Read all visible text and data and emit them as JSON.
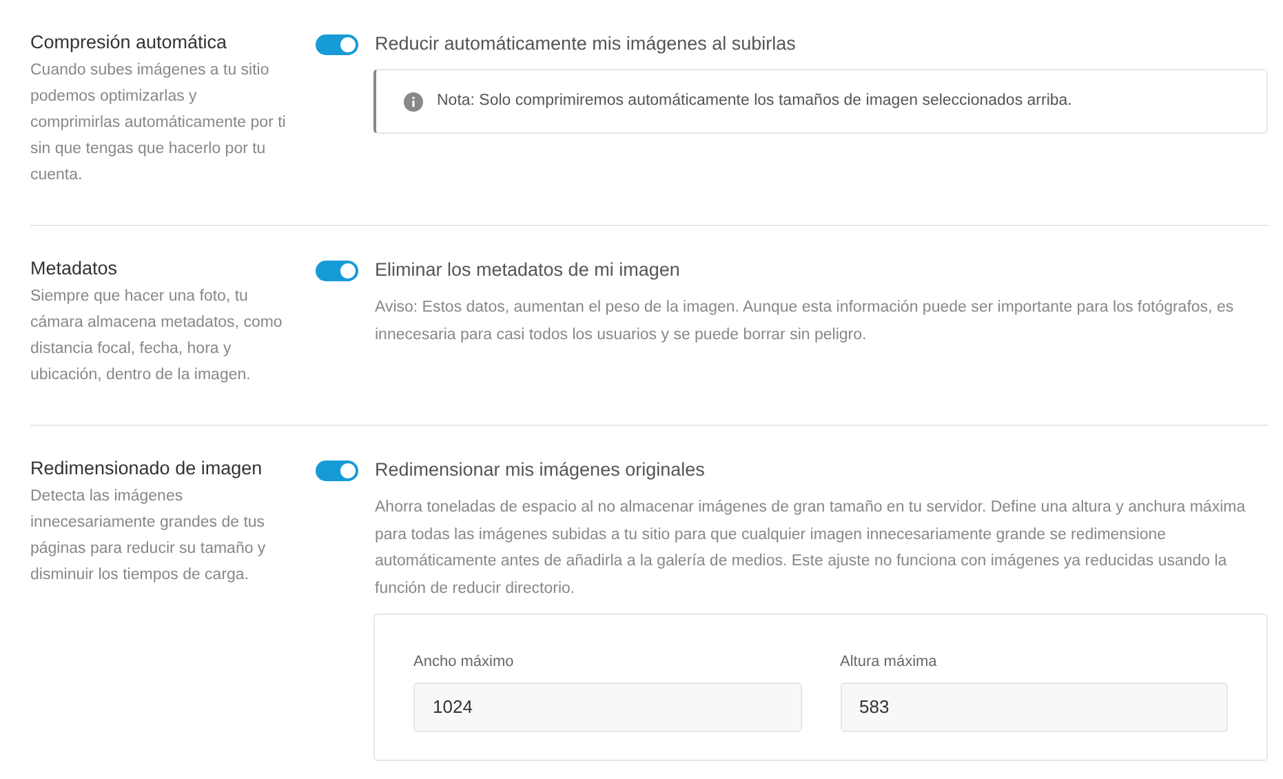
{
  "sections": [
    {
      "title": "Compresión automática",
      "description": "Cuando subes imágenes a tu sitio podemos optimizarlas y comprimirlas automáticamente por ti sin que tengas que hacerlo por tu cuenta.",
      "toggle": {
        "label": "Reducir automáticamente mis imágenes al subirlas",
        "on": true
      },
      "note": "Nota: Solo comprimiremos automáticamente los tamaños de imagen seleccionados arriba."
    },
    {
      "title": "Metadatos",
      "description": "Siempre que hacer una foto, tu cámara almacena metadatos, como distancia focal, fecha, hora y ubicación, dentro de la imagen.",
      "toggle": {
        "label": "Eliminar los metadatos de mi imagen",
        "on": true
      },
      "help": "Aviso: Estos datos, aumentan el peso de la imagen. Aunque esta información puede ser importante para los fotógrafos, es innecesaria para casi todos los usuarios y se puede borrar sin peligro."
    },
    {
      "title": "Redimensionado de imagen",
      "description": "Detecta las imágenes innecesariamente grandes de tus páginas para reducir su tamaño y disminuir los tiempos de carga.",
      "toggle": {
        "label": "Redimensionar mis imágenes originales",
        "on": true
      },
      "help": "Ahorra toneladas de espacio al no almacenar imágenes de gran tamaño en tu servidor. Define una altura y anchura máxima para todas las imágenes subidas a tu sitio para que cualquier imagen innecesariamente grande se redimensione automáticamente antes de añadirla a la galería de medios. Este ajuste no funciona con imágenes ya reducidas usando la función de reducir directorio.",
      "fields": [
        {
          "label": "Ancho máximo",
          "value": "1024"
        },
        {
          "label": "Altura máxima",
          "value": "583"
        }
      ]
    }
  ]
}
